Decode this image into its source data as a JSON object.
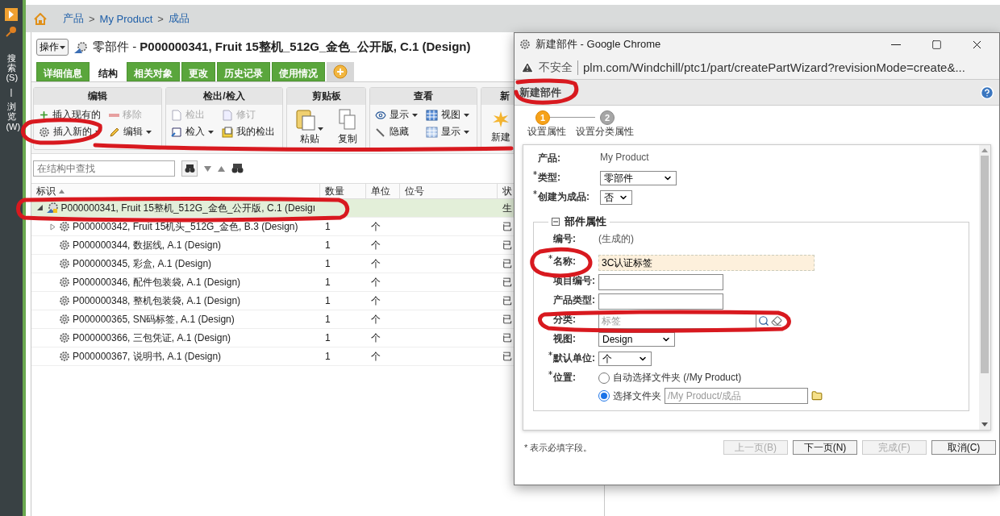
{
  "sidebar": {
    "tabs": [
      {
        "label": "搜索(S)"
      },
      {
        "label": "浏览(W)"
      }
    ],
    "separator": "|"
  },
  "breadcrumb": {
    "items": [
      "产品",
      "My Product",
      "成品"
    ],
    "separator": ">"
  },
  "header": {
    "actions_button": "操作",
    "title": "零部件 - **P000000341, Fruit 15整机_512G_金色_公开版, C.1 (Design)**"
  },
  "tabs": [
    {
      "kind": "text",
      "label": "详细信息",
      "selected": false
    },
    {
      "kind": "text",
      "label": "结构",
      "selected": true
    },
    {
      "kind": "text",
      "label": "相关对象",
      "selected": false
    },
    {
      "kind": "text",
      "label": "更改",
      "selected": false
    },
    {
      "kind": "text",
      "label": "历史记录",
      "selected": false
    },
    {
      "kind": "text",
      "label": "使用情况",
      "selected": false
    },
    {
      "kind": "add",
      "selected": false
    }
  ],
  "toolbar": {
    "groups": [
      {
        "title": "编辑",
        "items": [
          {
            "kind": "small",
            "label": "插入现有的",
            "disabled": false,
            "dropdown": false
          },
          {
            "kind": "small",
            "label": "移除",
            "disabled": true,
            "dropdown": false
          },
          {
            "kind": "small",
            "label": "插入新的",
            "disabled": false,
            "dropdown": true
          },
          {
            "kind": "small",
            "label": "编辑",
            "disabled": false,
            "dropdown": true
          }
        ]
      },
      {
        "title": "检出/检入",
        "items": [
          {
            "kind": "small",
            "label": "检出",
            "disabled": true,
            "dropdown": false
          },
          {
            "kind": "small",
            "label": "修订",
            "disabled": true,
            "dropdown": false
          },
          {
            "kind": "small",
            "label": "检入",
            "disabled": false,
            "dropdown": true
          },
          {
            "kind": "small",
            "label": "我的检出",
            "disabled": false,
            "dropdown": false
          }
        ]
      },
      {
        "title": "剪贴板",
        "items": [
          {
            "kind": "large",
            "label": "粘贴",
            "disabled": false,
            "dropdown": true
          },
          {
            "kind": "large",
            "label": "复制",
            "disabled": false,
            "dropdown": false
          }
        ]
      },
      {
        "title": "查看",
        "items": [
          {
            "kind": "small",
            "label": "显示",
            "disabled": false,
            "dropdown": true
          },
          {
            "kind": "small",
            "label": "视图",
            "disabled": false,
            "dropdown": true
          },
          {
            "kind": "small",
            "label": "隐藏",
            "disabled": false,
            "dropdown": false
          },
          {
            "kind": "small",
            "label": "显示",
            "disabled": false,
            "dropdown": true
          }
        ]
      },
      {
        "title": "新",
        "items": [
          {
            "kind": "large",
            "label": "新建",
            "disabled": false,
            "dropdown": false
          }
        ]
      }
    ]
  },
  "search": {
    "placeholder": "在结构中查找"
  },
  "table": {
    "columns": [
      "标识",
      "数量",
      "单位",
      "位号",
      "状"
    ],
    "rows": [
      {
        "label": "P000000341, Fruit 15整机_512G_金色_公开版, C.1 (Desigı",
        "status": "生",
        "selected": true,
        "expanded": true,
        "children": [
          {
            "label": "P000000342, Fruit 15机头_512G_金色, B.3 (Design)",
            "quantity": "1",
            "unit": "个",
            "status": "已",
            "selected": false,
            "expanded": false
          },
          {
            "label": "P000000344, 数据线, A.1 (Design)",
            "quantity": "1",
            "unit": "个",
            "status": "已",
            "selected": false
          },
          {
            "label": "P000000345, 彩盒, A.1 (Design)",
            "quantity": "1",
            "unit": "个",
            "status": "已",
            "selected": false
          },
          {
            "label": "P000000346, 配件包装袋, A.1 (Design)",
            "quantity": "1",
            "unit": "个",
            "status": "已",
            "selected": false
          },
          {
            "label": "P000000348, 整机包装袋, A.1 (Design)",
            "quantity": "1",
            "unit": "个",
            "status": "已",
            "selected": false
          },
          {
            "label": "P000000365, SN码标签, A.1 (Design)",
            "quantity": "1",
            "unit": "个",
            "status": "已",
            "selected": false
          },
          {
            "label": "P000000366, 三包凭证, A.1 (Design)",
            "quantity": "1",
            "unit": "个",
            "status": "已",
            "selected": false
          },
          {
            "label": "P000000367, 说明书, A.1 (Design)",
            "quantity": "1",
            "unit": "个",
            "status": "已",
            "selected": false
          }
        ]
      }
    ]
  },
  "popup": {
    "window_title": "新建部件 - Google Chrome",
    "security": "不安全",
    "url": "plm.com/Windchill/ptc1/part/createPartWizard?revisionMode=create&...",
    "wizard_title": "新建部件",
    "steps": [
      {
        "number": "1",
        "label": "设置属性",
        "selected": true
      },
      {
        "number": "2",
        "label": "设置分类属性",
        "selected": false
      }
    ],
    "fields": [
      {
        "kind": "text",
        "label": "产品:",
        "required": false,
        "value": "My Product"
      },
      {
        "kind": "select",
        "label": "类型:",
        "required": true,
        "value": "零部件"
      },
      {
        "kind": "select",
        "label": "创建为成品:",
        "required": true,
        "value": "否"
      }
    ],
    "section": {
      "title": "部件属性",
      "expanded": true,
      "fields": [
        {
          "kind": "text",
          "label": "编号:",
          "required": false,
          "value": "(生成的)"
        },
        {
          "kind": "input",
          "label": "名称:",
          "required": true,
          "value": "3C认证标签",
          "focused": true
        },
        {
          "kind": "input",
          "label": "项目编号:",
          "required": false,
          "focused": false
        },
        {
          "kind": "input",
          "label": "产品类型:",
          "required": false,
          "focused": false
        },
        {
          "kind": "lookup",
          "label": "分类:",
          "required": false,
          "placeholder": "标签"
        },
        {
          "kind": "select",
          "label": "视图:",
          "required": false,
          "value": "Design"
        },
        {
          "kind": "select",
          "label": "默认单位:",
          "required": true,
          "value": "个"
        },
        {
          "kind": "radio",
          "label": "位置:",
          "required": true,
          "options": [
            {
              "label": "自动选择文件夹 (/My Product)",
              "selected": false
            },
            {
              "label": "选择文件夹",
              "selected": true,
              "placeholder": "/My Product/成品"
            }
          ]
        }
      ]
    },
    "footnote": "* 表示必填字段。",
    "buttons": [
      {
        "label": "上一页(B)",
        "disabled": true
      },
      {
        "label": "下一页(N)",
        "disabled": false
      },
      {
        "label": "完成(F)",
        "disabled": true
      },
      {
        "label": "取消(C)",
        "disabled": false
      }
    ]
  }
}
